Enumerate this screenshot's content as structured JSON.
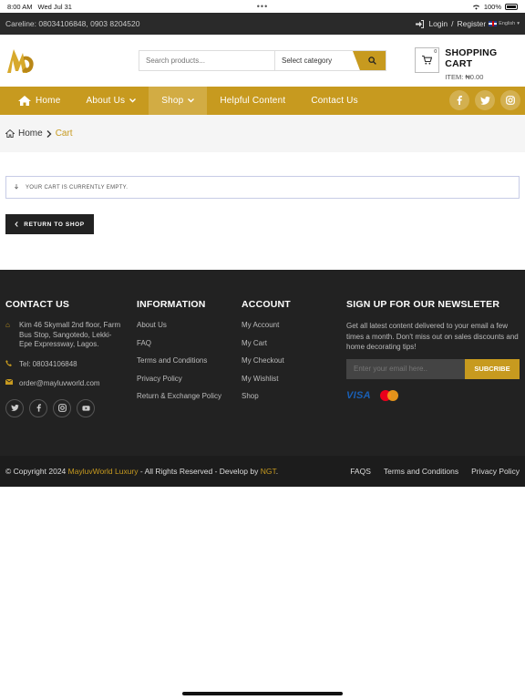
{
  "status": {
    "time": "8:00 AM",
    "date": "Wed Jul 31",
    "battery": "100%"
  },
  "topbar": {
    "careline": "Careline: 08034106848, 0903 8204520",
    "login": "Login",
    "sep": "/",
    "register": "Register",
    "lang": "English"
  },
  "header": {
    "search_placeholder": "Search products...",
    "category": "Select category",
    "cart_title": "SHOPPING CART",
    "cart_items": "ITEM: ₦0.00",
    "cart_count": "0"
  },
  "nav": {
    "items": [
      "Home",
      "About Us",
      "Shop",
      "Helpful Content",
      "Contact Us"
    ]
  },
  "breadcrumb": {
    "home": "Home",
    "current": "Cart"
  },
  "cart": {
    "empty_msg": "YOUR CART IS CURRENTLY EMPTY.",
    "return_btn": "RETURN TO SHOP"
  },
  "footer": {
    "contact": {
      "title": "CONTACT US",
      "address": "Kim 46 Skymall 2nd floor, Farm Bus Stop, Sangotedo, Lekki-Epe Expressway, Lagos.",
      "tel": "Tel: 08034106848",
      "email": "order@mayluvworld.com"
    },
    "info": {
      "title": "INFORMATION",
      "links": [
        "About Us",
        "FAQ",
        "Terms and Conditions",
        "Privacy Policy",
        "Return & Exchange Policy"
      ]
    },
    "account": {
      "title": "ACCOUNT",
      "links": [
        "My Account",
        "My Cart",
        "My Checkout",
        "My Wishlist",
        "Shop"
      ]
    },
    "newsletter": {
      "title": "SIGN UP FOR OUR NEWSLETER",
      "text": "Get all latest content delivered to your email a few times a month. Don't miss out on sales discounts and home decorating tips!",
      "placeholder": "Enter your email here..",
      "button": "SUBCRIBE",
      "visa": "VISA"
    }
  },
  "copyright": {
    "prefix": "© Copyright 2024",
    "brand": "MayluvWorld Luxury",
    "middle": "- All Rights Reserved - Develop by",
    "dev": "NGT",
    "end": ".",
    "links": [
      "FAQS",
      "Terms and Conditions",
      "Privacy Policy"
    ]
  },
  "colors": {
    "accent": "#c79a1f",
    "dark": "#222222",
    "topbar": "#2a2a2a"
  }
}
